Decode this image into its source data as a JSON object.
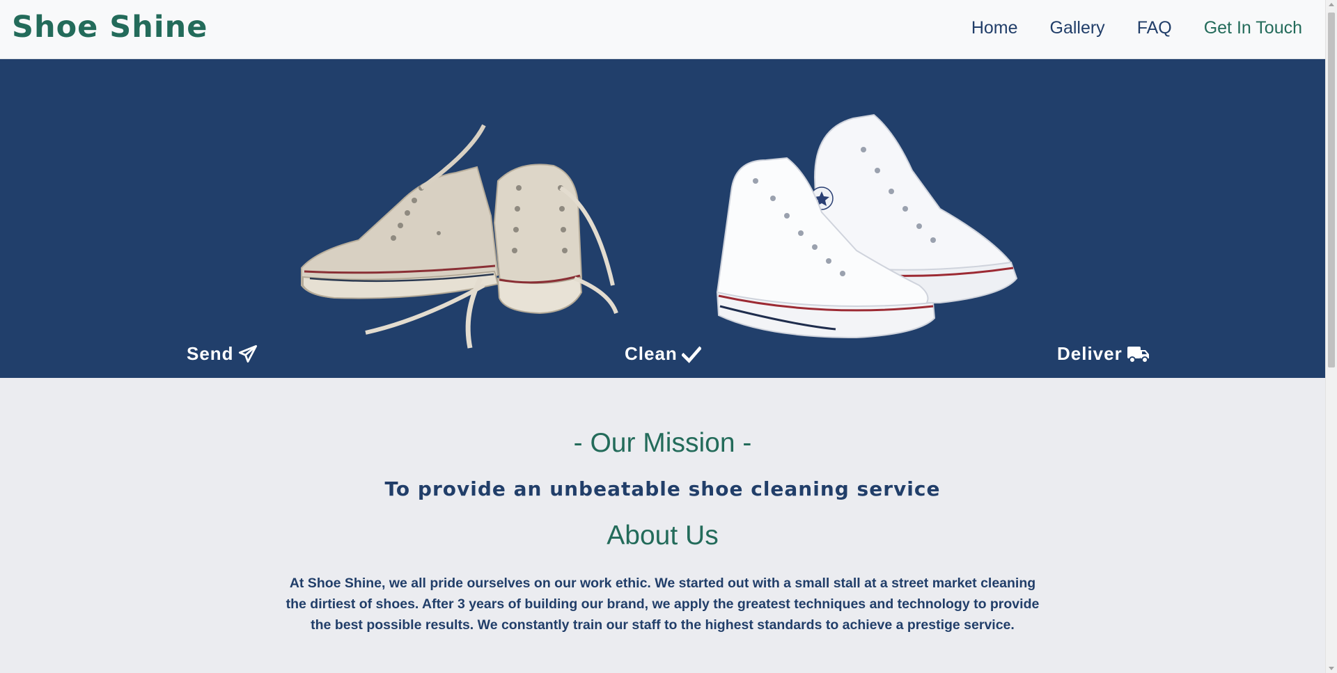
{
  "header": {
    "brand": "Shoe Shine",
    "nav": [
      {
        "label": "Home",
        "active": false
      },
      {
        "label": "Gallery",
        "active": false
      },
      {
        "label": "FAQ",
        "active": false
      },
      {
        "label": "Get In Touch",
        "active": true
      }
    ]
  },
  "hero": {
    "before_image": "dirty-sneakers-image",
    "after_image": "clean-sneakers-image",
    "steps": [
      {
        "label": "Send",
        "icon": "paper-plane-icon"
      },
      {
        "label": "Clean",
        "icon": "check-icon"
      },
      {
        "label": "Deliver",
        "icon": "truck-icon"
      }
    ]
  },
  "mission": {
    "title": "- Our Mission -",
    "text": "To provide an unbeatable shoe cleaning service"
  },
  "about": {
    "title": "About Us",
    "text": "At Shoe Shine, we all pride ourselves on our work ethic. We started out with a small stall at a street market cleaning the dirtiest of shoes. After 3 years of building our brand, we apply the greatest techniques and technology to provide the best possible results. We constantly train our staff to the highest standards to achieve a prestige service."
  },
  "colors": {
    "primary_navy": "#213f6b",
    "accent_green": "#236b5a",
    "page_bg": "#ebecf0",
    "header_bg": "#f8f9fa"
  }
}
